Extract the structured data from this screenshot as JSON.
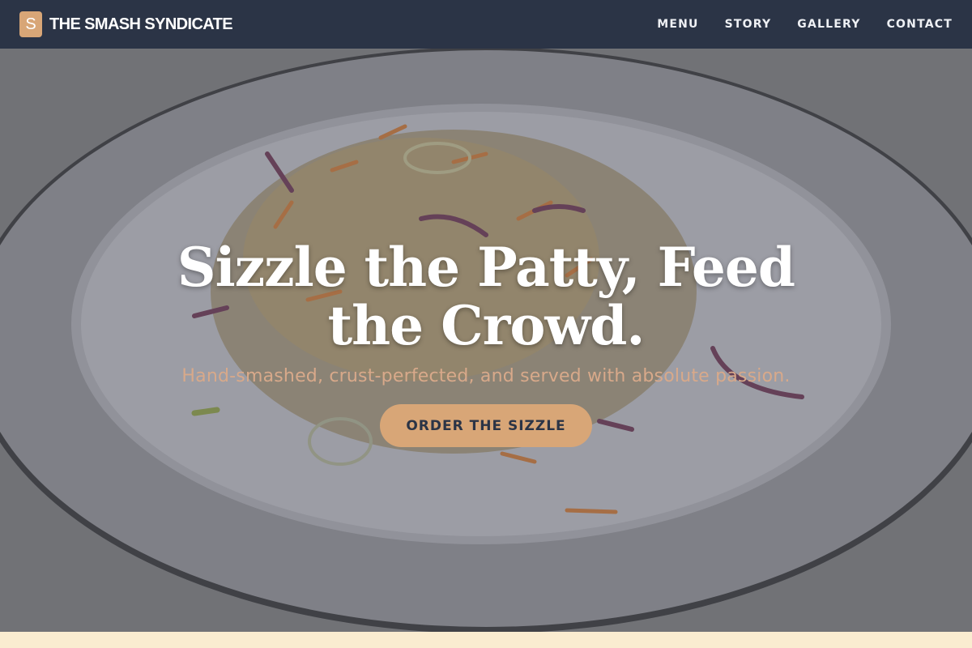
{
  "brand": {
    "logo_letter": "S",
    "name": "THE SMASH SYNDICATE"
  },
  "nav": {
    "items": [
      {
        "label": "MENU"
      },
      {
        "label": "STORY"
      },
      {
        "label": "GALLERY"
      },
      {
        "label": "CONTACT"
      }
    ]
  },
  "hero": {
    "title": "Sizzle the Patty, Feed the Crowd.",
    "subtitle": "Hand-smashed, crust-perfected, and served with absolute passion.",
    "cta_label": "ORDER THE SIZZLE",
    "image_subject": "plate-of-coleslaw"
  },
  "colors": {
    "navbar_bg": "#2b3446",
    "accent": "#d8a677",
    "hero_overlay": "#7b7b7e",
    "footer_strip": "#faecd0"
  }
}
